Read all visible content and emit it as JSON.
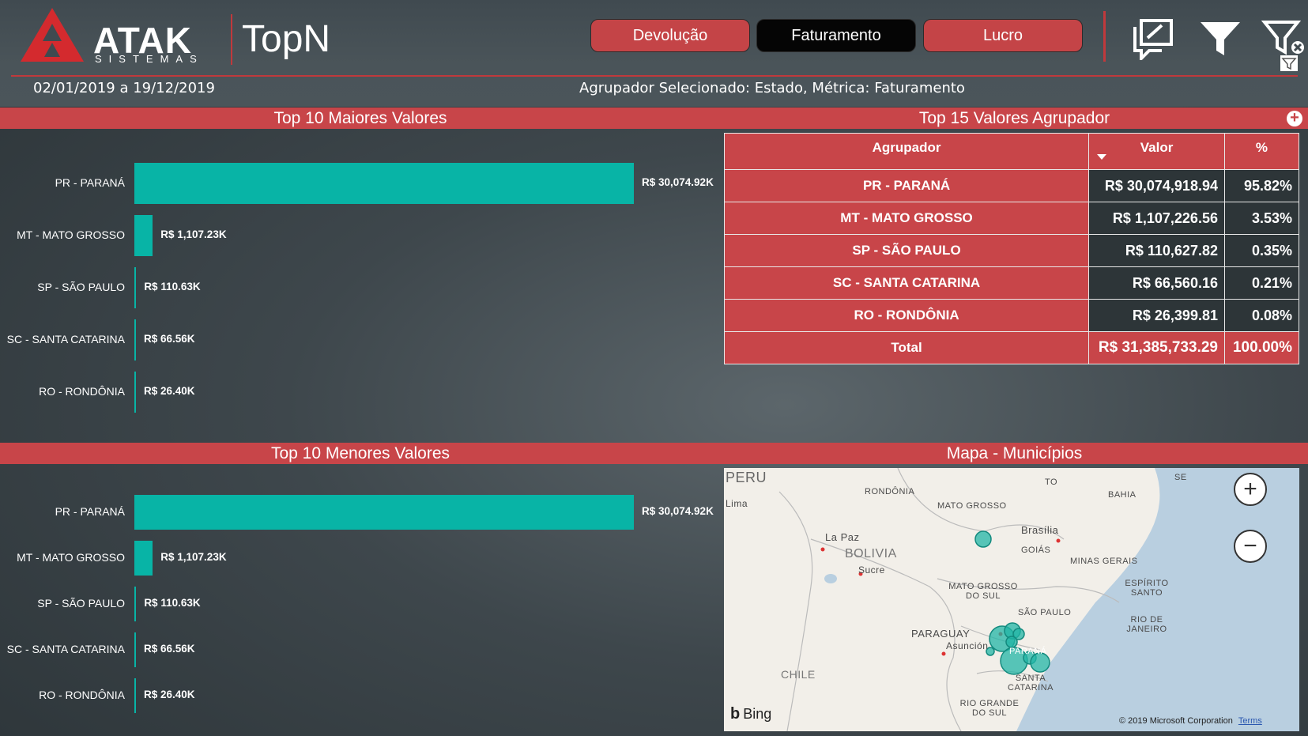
{
  "header": {
    "logo_word": "ATAK",
    "logo_sub": "SISTEMAS",
    "app_title": "TopN",
    "buttons": [
      "Devolução",
      "Faturamento",
      "Lucro"
    ],
    "active_button": "Faturamento",
    "date_range": "02/01/2019 a 19/12/2019",
    "selection_text": "Agrupador Selecionado: Estado, Métrica: Faturamento",
    "icons": [
      "comment-icon",
      "filter-icon",
      "clear-filter-icon"
    ]
  },
  "top_chart": {
    "title": "Top 10 Maiores Valores"
  },
  "bottom_chart": {
    "title": "Top 10 Menores Valores"
  },
  "chart_data": [
    {
      "type": "bar",
      "title": "Top 10 Maiores Valores",
      "orientation": "horizontal",
      "categories": [
        "PR - PARANÁ",
        "MT - MATO GROSSO",
        "SP - SÃO PAULO",
        "SC - SANTA CATARINA",
        "RO - RONDÔNIA"
      ],
      "values": [
        30074.92,
        1107.23,
        110.63,
        66.56,
        26.4
      ],
      "data_labels": [
        "R$ 30,074.92K",
        "R$ 1,107.23K",
        "R$ 110.63K",
        "R$ 66.56K",
        "R$ 26.40K"
      ],
      "unit": "R$ K"
    },
    {
      "type": "bar",
      "title": "Top 10 Menores Valores",
      "orientation": "horizontal",
      "categories": [
        "PR - PARANÁ",
        "MT - MATO GROSSO",
        "SP - SÃO PAULO",
        "SC - SANTA CATARINA",
        "RO - RONDÔNIA"
      ],
      "values": [
        30074.92,
        1107.23,
        110.63,
        66.56,
        26.4
      ],
      "data_labels": [
        "R$ 30,074.92K",
        "R$ 1,107.23K",
        "R$ 110.63K",
        "R$ 66.56K",
        "R$ 26.40K"
      ],
      "unit": "R$ K"
    }
  ],
  "table": {
    "title": "Top 15 Valores Agrupador",
    "headers": [
      "Agrupador",
      "Valor",
      "%"
    ],
    "rows": [
      [
        "PR - PARANÁ",
        "R$ 30,074,918.94",
        "95.82%"
      ],
      [
        "MT - MATO GROSSO",
        "R$ 1,107,226.56",
        "3.53%"
      ],
      [
        "SP - SÃO PAULO",
        "R$ 110,627.82",
        "0.35%"
      ],
      [
        "SC - SANTA CATARINA",
        "R$ 66,560.16",
        "0.21%"
      ],
      [
        "RO - RONDÔNIA",
        "R$ 26,399.81",
        "0.08%"
      ]
    ],
    "total": [
      "Total",
      "R$ 31,385,733.29",
      "100.00%"
    ]
  },
  "map": {
    "title": "Mapa - Municípios",
    "labels": [
      "PERU",
      "Lima",
      "RONDÔNIA",
      "MATO GROSSO",
      "TO",
      "BAHIA",
      "SE",
      "La Paz",
      "BOLIVIA",
      "Sucre",
      "Brasília",
      "GOIÁS",
      "MINAS GERAIS",
      "ESPÍRITO SANTO",
      "MATO GROSSO DO SUL",
      "SÃO PAULO",
      "RIO DE JANEIRO",
      "PARAGUAY",
      "Asunción",
      "PARANÁ",
      "CHILE",
      "SANTA CATARINA",
      "RIO GRANDE DO SUL"
    ],
    "bing": "Bing",
    "copyright": "© 2019 Microsoft Corporation",
    "terms": "Terms",
    "zoom_in": "+",
    "zoom_out": "−"
  },
  "colors": {
    "accent_red": "#c84549",
    "bar_teal": "#08b4a6",
    "active_black": "#050505"
  }
}
